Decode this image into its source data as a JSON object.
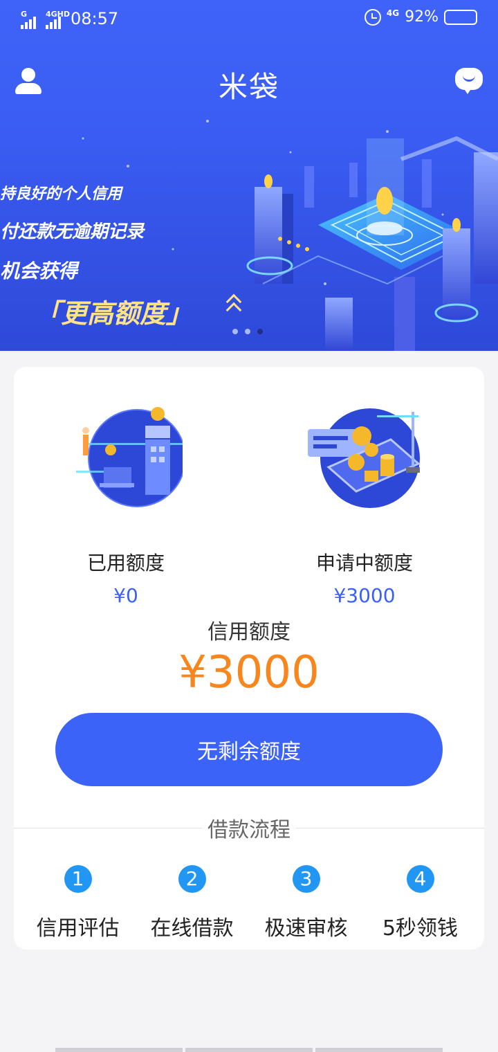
{
  "status_bar": {
    "signal_1_tag": "G",
    "signal_2_tag": "4GHD",
    "time": "08:57",
    "network_tag": "4G",
    "battery": "92%",
    "battery_level": 0.92
  },
  "header": {
    "title": "米袋"
  },
  "banner": {
    "line1": "持良好的个人信用",
    "line2": "付还款无逾期记录",
    "line3": "机会获得",
    "line4": "「更高额度」",
    "page_count": 3,
    "active_page": 3
  },
  "quota": {
    "used_label": "已用额度",
    "used_value": "¥0",
    "applying_label": "申请中额度",
    "applying_value": "¥3000"
  },
  "credit": {
    "label": "信用额度",
    "amount": "¥3000"
  },
  "cta": {
    "label": "无剩余额度"
  },
  "flow": {
    "title": "借款流程",
    "steps": [
      {
        "num": "1",
        "label": "信用评估"
      },
      {
        "num": "2",
        "label": "在线借款"
      },
      {
        "num": "3",
        "label": "极速审核"
      },
      {
        "num": "4",
        "label": "5秒领钱"
      }
    ]
  },
  "colors": {
    "brand_blue": "#3b63f7",
    "amount_orange": "#f6861d",
    "step_blue": "#2196f3"
  }
}
